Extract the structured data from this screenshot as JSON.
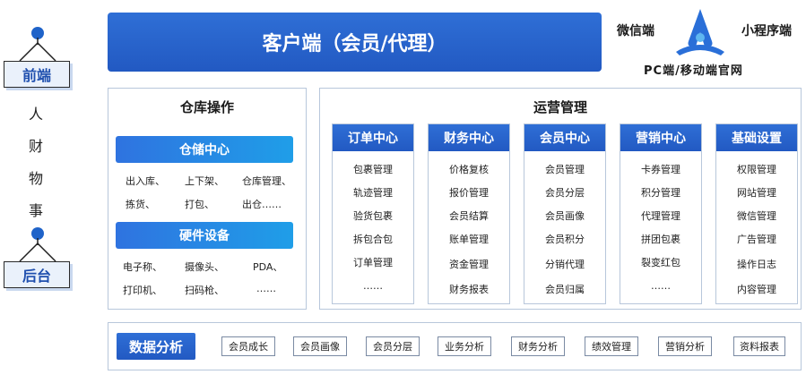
{
  "left_axis": {
    "front_label": "前端",
    "back_label": "后台",
    "vertical_chars": [
      "人",
      "财",
      "物",
      "事"
    ]
  },
  "client": {
    "title": "客户端（会员/代理）"
  },
  "logo": {
    "left_text": "微信端",
    "right_text": "小程序端",
    "bottom_text": "PC端/移动端官网"
  },
  "warehouse": {
    "title": "仓库操作",
    "storage": {
      "label": "仓储中心",
      "items": [
        "出入库、",
        "上下架、",
        "仓库管理、",
        "拣货、",
        "打包、",
        "出仓……"
      ]
    },
    "hardware": {
      "label": "硬件设备",
      "items": [
        "电子称、",
        "摄像头、",
        "PDA、",
        "打印机、",
        "扫码枪、",
        "……"
      ]
    }
  },
  "operations": {
    "title": "运营管理",
    "columns": [
      {
        "label": "订单中心",
        "items": [
          "包裹管理",
          "轨迹管理",
          "验货包裹",
          "拆包合包",
          "订单管理",
          "……"
        ]
      },
      {
        "label": "财务中心",
        "items": [
          "价格复核",
          "报价管理",
          "会员结算",
          "账单管理",
          "资金管理",
          "财务报表"
        ]
      },
      {
        "label": "会员中心",
        "items": [
          "会员管理",
          "会员分层",
          "会员画像",
          "会员积分",
          "分销代理",
          "会员归属"
        ]
      },
      {
        "label": "营销中心",
        "items": [
          "卡券管理",
          "积分管理",
          "代理管理",
          "拼团包裹",
          "裂变红包",
          "……"
        ]
      },
      {
        "label": "基础设置",
        "items": [
          "权限管理",
          "网站管理",
          "微信管理",
          "广告管理",
          "操作日志",
          "内容管理"
        ]
      }
    ]
  },
  "analysis": {
    "label": "数据分析",
    "tags": [
      "会员成长",
      "会员画像",
      "会员分层",
      "业务分析",
      "财务分析",
      "绩效管理",
      "营销分析",
      "资料报表"
    ]
  },
  "colors": {
    "primary": "#2259c2",
    "accent": "#1f9ee8",
    "border": "#b8c7db"
  }
}
